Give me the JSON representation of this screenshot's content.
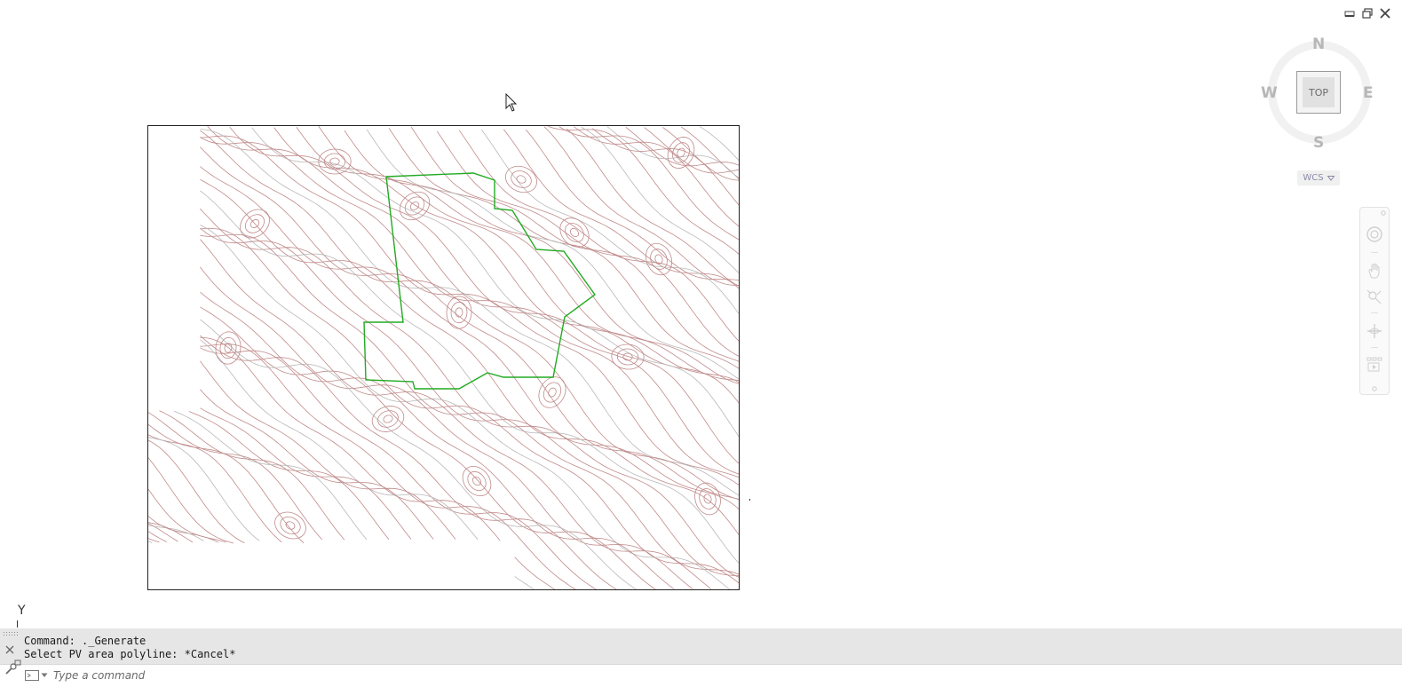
{
  "window": {
    "controls": [
      "minimize-icon",
      "restore-icon",
      "close-icon"
    ]
  },
  "viewcube": {
    "north": "N",
    "south": "S",
    "east": "E",
    "west": "W",
    "face": "TOP",
    "ucs_menu": "WCS"
  },
  "navbar": {
    "tools": [
      "full-navigation-wheel-icon",
      "pan-icon",
      "zoom-extents-icon",
      "orbit-icon",
      "showmotion-icon"
    ]
  },
  "ucs": {
    "axis_label": "Y"
  },
  "command_line": {
    "history": [
      "Command: ._Generate",
      "Select PV area polyline: *Cancel*"
    ],
    "placeholder": "Type a command"
  },
  "colors": {
    "contour": "#c08a8a",
    "contour_minor": "#b8b8b8",
    "boundary": "#22aa22",
    "frame": "#222222",
    "command_bg": "#e6e6e6"
  }
}
